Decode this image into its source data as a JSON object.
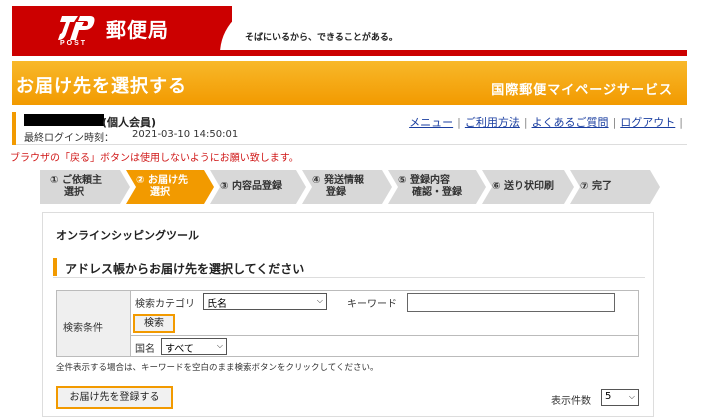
{
  "header": {
    "logo_text": "JP",
    "logo_post": "POST",
    "brand_name": "郵便局",
    "tagline": "そばにいるから、できることがある。"
  },
  "title_bar": {
    "title": "お届け先を選択する",
    "service_name": "国際郵便マイページサービス"
  },
  "user": {
    "account_type": "(個人会員)",
    "last_login_label": "最終ログイン時刻：",
    "last_login_time": "2021-03-10 14:50:01",
    "links": [
      "メニュー",
      "ご利用方法",
      "よくあるご質問",
      "ログアウト"
    ]
  },
  "warning": "ブラウザの「戻る」ボタンは使用しないようにお願い致します。",
  "steps": [
    {
      "line1": "① ご依頼主",
      "line2": "選択",
      "active": false
    },
    {
      "line1": "② お届け先",
      "line2": "選択",
      "active": true
    },
    {
      "line1": "③ 内容品登録",
      "line2": "",
      "active": false
    },
    {
      "line1": "④ 発送情報",
      "line2": "登録",
      "active": false
    },
    {
      "line1": "⑤ 登録内容",
      "line2": "確認・登録",
      "active": false
    },
    {
      "line1": "⑥ 送り状印刷",
      "line2": "",
      "active": false
    },
    {
      "line1": "⑦ 完了",
      "line2": "",
      "active": false
    }
  ],
  "panel": {
    "tool_title": "オンラインシッピングツール",
    "section_title": "アドレス帳からお届け先を選択してください",
    "search": {
      "conditions_label": "検索条件",
      "category_label": "検索カテゴリ",
      "category_value": "氏名",
      "keyword_label": "キーワード",
      "keyword_value": "",
      "search_button": "検索",
      "country_label": "国名",
      "country_value": "すべて"
    },
    "note": "全件表示する場合は、キーワードを空白のまま検索ボタンをクリックしてください。",
    "register_button": "お届け先を登録する",
    "display_count_label": "表示件数",
    "display_count_value": "5"
  },
  "colors": {
    "brand_red": "#cc0000",
    "accent_orange": "#f29a00",
    "link_blue": "#1a3ea0",
    "warning_red": "#d01818"
  }
}
